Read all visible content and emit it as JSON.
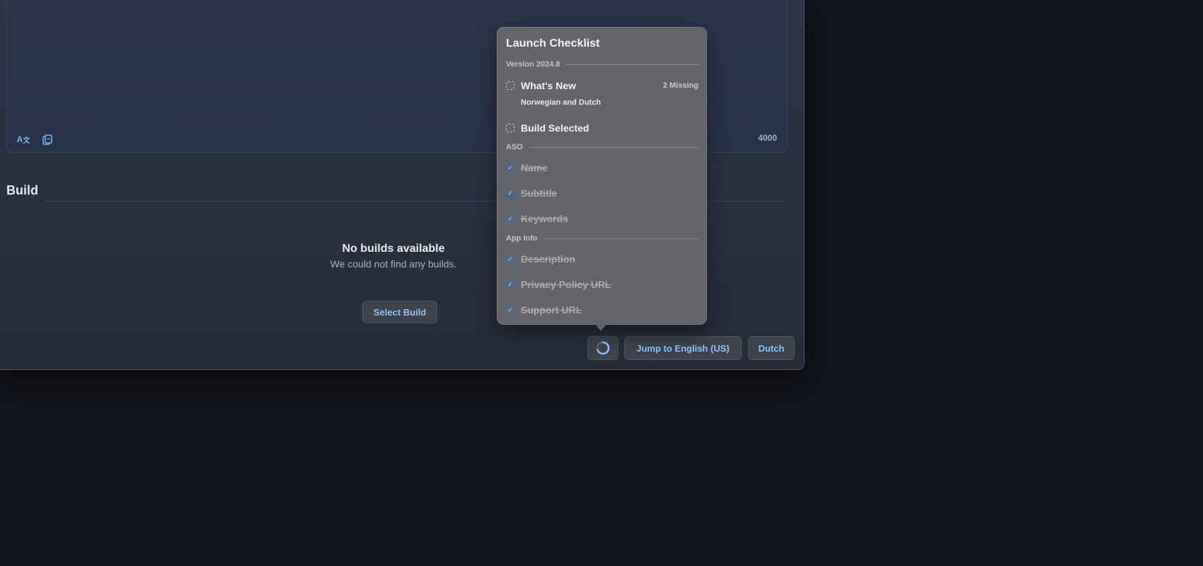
{
  "editor": {
    "translate_icon": "translate-icon",
    "copy_icon": "copy-icon",
    "char_count": "4000"
  },
  "build": {
    "title": "Build",
    "empty_title": "No builds available",
    "empty_subtitle": "We could not find any builds.",
    "select_label": "Select Build"
  },
  "footer": {
    "spinner_icon": "loading-spinner-icon",
    "jump_label": "Jump to English (US)",
    "locale_label": "Dutch"
  },
  "checklist": {
    "title": "Launch Checklist",
    "version_label": "Version 2024.8",
    "whats_new": {
      "label": "What's New",
      "badge": "2 Missing",
      "note": "Norwegian and Dutch"
    },
    "build_selected": {
      "label": "Build Selected"
    },
    "aso_label": "ASO",
    "aso_items": [
      {
        "label": "Name"
      },
      {
        "label": "Subtitle"
      },
      {
        "label": "Keywords"
      }
    ],
    "appinfo_label": "App Info",
    "appinfo_items": [
      {
        "label": "Description"
      },
      {
        "label": "Privacy Policy URL"
      },
      {
        "label": "Support URL"
      }
    ],
    "accent": "#8fc3ff"
  }
}
